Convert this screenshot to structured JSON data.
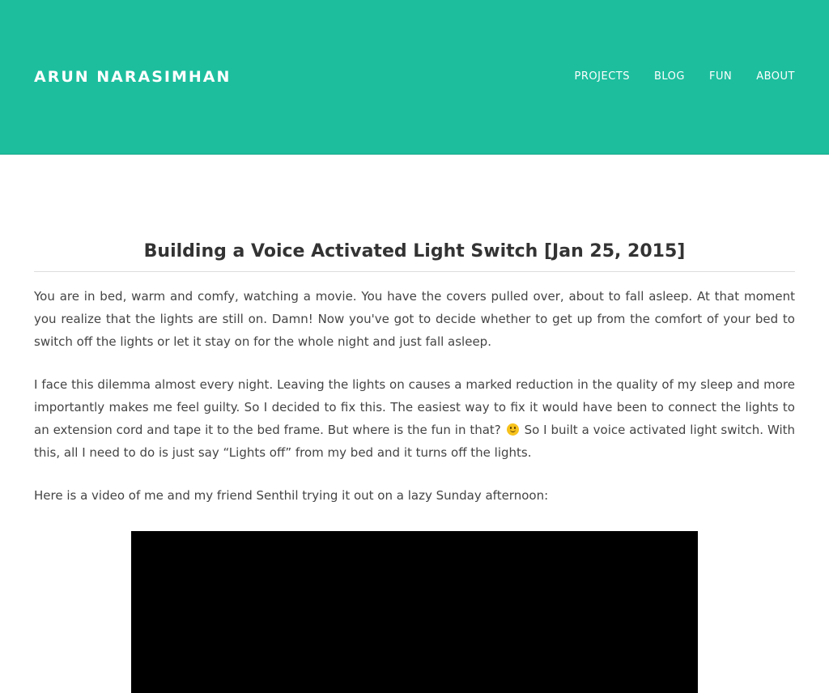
{
  "site": {
    "title": "ARUN NARASIMHAN",
    "header_color": "#1dbe9e"
  },
  "nav": {
    "items": [
      {
        "label": "PROJECTS"
      },
      {
        "label": "BLOG"
      },
      {
        "label": "FUN"
      },
      {
        "label": "ABOUT"
      }
    ]
  },
  "post": {
    "title": "Building a Voice Activated Light Switch [Jan 25, 2015]",
    "paragraph_1": "You are in bed, warm and comfy, watching a movie. You have the covers pulled over, about to fall asleep. At that moment you realize that the lights are still on. Damn! Now you've got to decide whether to get up from the comfort of your bed to switch off the lights or let it stay on for the whole night and just fall asleep.",
    "paragraph_2_before_emoji": "I face this dilemma almost every night. Leaving the lights on causes a marked reduction in the quality of my sleep and more importantly makes me feel guilty. So I decided to fix this. The easiest way to fix it would have been to connect the lights to an extension cord and tape it to the bed frame. But where is the fun in that?",
    "paragraph_2_after_emoji": "So I built a voice activated light switch. With this, all I need to do is just say “Lights off” from my bed and it turns off the lights.",
    "emoji_icon": "smiley-face-icon",
    "paragraph_3": "Here is a video of me and my friend Senthil trying it out on a lazy Sunday afternoon:"
  }
}
